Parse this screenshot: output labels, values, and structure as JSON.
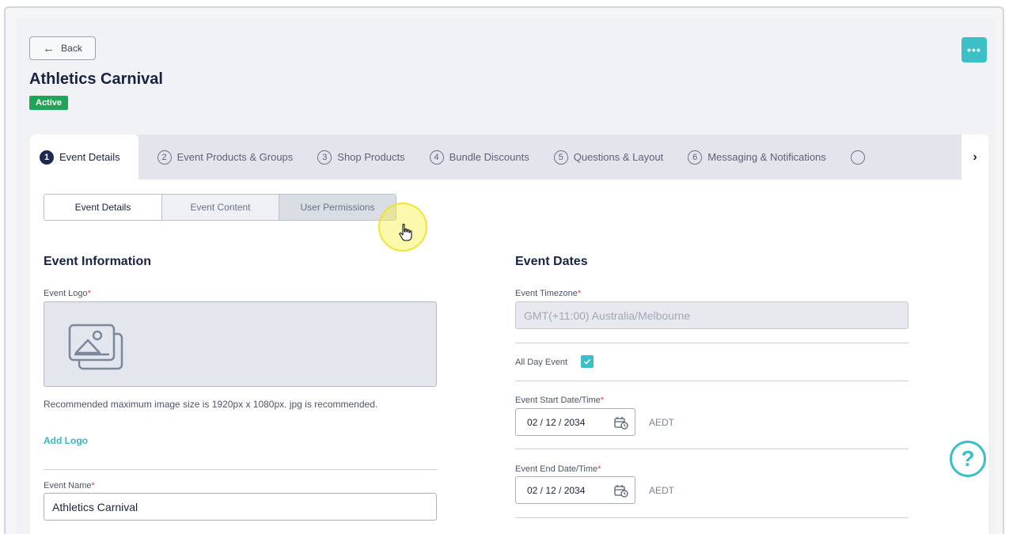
{
  "header": {
    "back_label": "Back",
    "more_label": "•••",
    "title": "Athletics Carnival",
    "status": "Active"
  },
  "tabs": [
    {
      "num": "1",
      "label": "Event Details",
      "active": true
    },
    {
      "num": "2",
      "label": "Event Products & Groups"
    },
    {
      "num": "3",
      "label": "Shop Products"
    },
    {
      "num": "4",
      "label": "Bundle Discounts"
    },
    {
      "num": "5",
      "label": "Questions & Layout"
    },
    {
      "num": "6",
      "label": "Messaging & Notifications"
    }
  ],
  "subtabs": [
    "Event Details",
    "Event Content",
    "User Permissions"
  ],
  "event_information": {
    "title": "Event Information",
    "logo_label": "Event Logo",
    "logo_hint": "Recommended maximum image size is 1920px x 1080px. jpg is recommended.",
    "add_logo": "Add Logo",
    "name_label": "Event Name",
    "name_value": "Athletics Carnival"
  },
  "event_dates": {
    "title": "Event Dates",
    "timezone_label": "Event Timezone",
    "timezone_value": "GMT(+11:00) Australia/Melbourne",
    "all_day_label": "All Day Event",
    "all_day_checked": true,
    "start_label": "Event Start Date/Time",
    "start_value": "02 / 12 / 2034",
    "start_tz": "AEDT",
    "end_label": "Event End Date/Time",
    "end_value": "02 / 12 / 2034",
    "end_tz": "AEDT"
  },
  "required_mark": "*",
  "help_label": "?",
  "colors": {
    "accent": "#3cbfc7",
    "active_badge": "#22a35a",
    "primary_text": "#18243e",
    "required": "#e0394c"
  }
}
